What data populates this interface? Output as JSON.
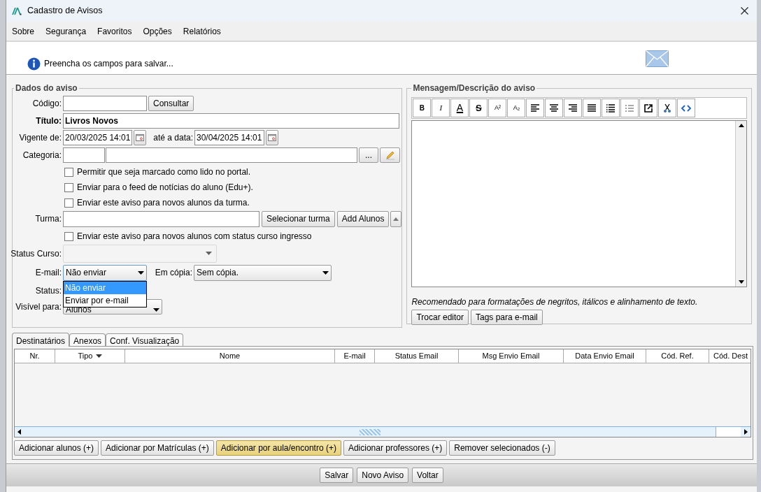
{
  "window": {
    "title": "Cadastro de Avisos"
  },
  "menu": [
    {
      "label": "Sobre"
    },
    {
      "label": "Segurança"
    },
    {
      "label": "Favoritos"
    },
    {
      "label": "Opções"
    },
    {
      "label": "Relatórios"
    }
  ],
  "info": {
    "message": "Preencha os campos para salvar..."
  },
  "dados": {
    "legend": "Dados do aviso",
    "codigo": {
      "label": "Código:",
      "button": "Consultar"
    },
    "titulo": {
      "label": "Título:",
      "value": "Livros Novos"
    },
    "vigente": {
      "label": "Vigente de:",
      "value": "20/03/2025 14:01",
      "until_label": "até a data:",
      "until_value": "30/04/2025 14:01"
    },
    "categoria": {
      "label": "Categoria:",
      "button": "..."
    },
    "options": [
      {
        "label": "Permitir que seja marcado como lido no portal.",
        "checked": false
      },
      {
        "label": "Enviar para o feed de notícias do aluno (Edu+).",
        "checked": false
      },
      {
        "label": "Enviar este aviso para novos alunos da turma.",
        "checked": false
      }
    ],
    "turma": {
      "label": "Turma:",
      "buttons": [
        "Selecionar turma",
        "Add Alunos"
      ]
    },
    "ingresso": {
      "label": "Enviar este aviso para novos alunos com status curso ingresso",
      "checked": false
    },
    "status_curso": {
      "label": "Status Curso:",
      "disabled": true
    },
    "email": {
      "label": "E-mail:",
      "value": "Não enviar",
      "cc_label": "Em cópia:",
      "cc_value": "Sem cópia.",
      "options": [
        {
          "label": "Não enviar",
          "selected": true
        },
        {
          "label": "Enviar por e-mail",
          "selected": false
        }
      ]
    },
    "status": {
      "label": "Status:"
    },
    "visivel": {
      "label": "Visível para:",
      "value": "Alunos"
    }
  },
  "mensagem": {
    "legend": "Mensagem/Descrição do aviso",
    "toolbar": [
      {
        "kind": "bold",
        "glyph": "B"
      },
      {
        "kind": "italic",
        "glyph": "I"
      },
      {
        "kind": "color",
        "glyph": "A"
      },
      {
        "kind": "strike",
        "glyph": "S"
      },
      {
        "kind": "sup",
        "glyph": "A²"
      },
      {
        "kind": "sub",
        "glyph": "A₂"
      },
      {
        "kind": "align-left"
      },
      {
        "kind": "align-center"
      },
      {
        "kind": "align-right"
      },
      {
        "kind": "justify"
      },
      {
        "kind": "bullets"
      },
      {
        "kind": "numbers"
      },
      {
        "kind": "external"
      },
      {
        "kind": "cut"
      },
      {
        "kind": "code"
      }
    ],
    "note": "Recomendado para formatações de negritos, itálicos e alinhamento de texto.",
    "buttons": [
      "Trocar editor",
      "Tags para e-mail"
    ]
  },
  "tabs": [
    {
      "label": "Destinatários",
      "selected": true
    },
    {
      "label": "Anexos",
      "selected": false
    },
    {
      "label": "Conf. Visualização",
      "selected": false
    }
  ],
  "table": {
    "columns": [
      {
        "label": "Nr.",
        "sorted": false
      },
      {
        "label": "Tipo",
        "sorted": true
      },
      {
        "label": "Nome",
        "sorted": false
      },
      {
        "label": "E-mail",
        "sorted": false
      },
      {
        "label": "Status Email",
        "sorted": false
      },
      {
        "label": "Msg Envio Email",
        "sorted": false
      },
      {
        "label": "Data Envio Email",
        "sorted": false
      },
      {
        "label": "Cód. Ref.",
        "sorted": false
      },
      {
        "label": "Cód. Dest",
        "sorted": false
      }
    ]
  },
  "actions": [
    {
      "label": "Adicionar alunos (+)",
      "highlighted": false
    },
    {
      "label": "Adicionar por Matrículas (+)",
      "highlighted": false
    },
    {
      "label": "Adicionar por aula/encontro (+)",
      "highlighted": true
    },
    {
      "label": "Adicionar professores (+)",
      "highlighted": false
    },
    {
      "label": "Remover selecionados (-)",
      "highlighted": false
    }
  ],
  "footer_buttons": [
    "Salvar",
    "Novo Aviso",
    "Voltar"
  ]
}
